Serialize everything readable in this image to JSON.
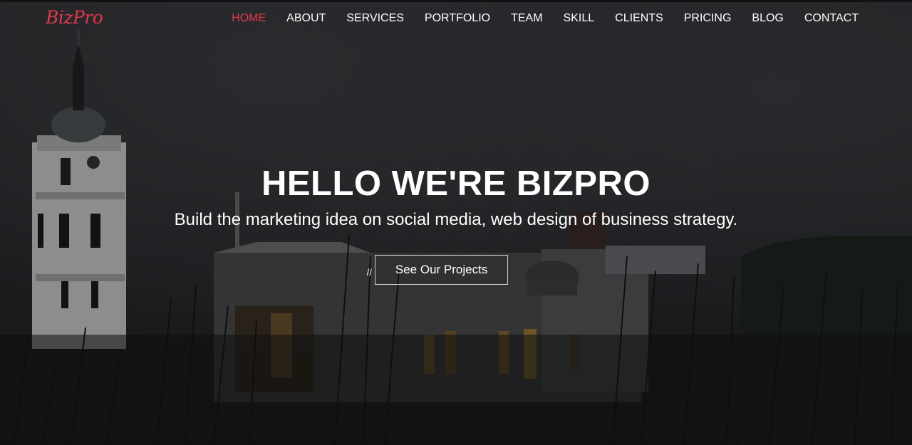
{
  "brand": {
    "logo_text": "BizPro",
    "accent_color": "#e4364d"
  },
  "nav": {
    "items": [
      {
        "label": "HOME",
        "active": true
      },
      {
        "label": "ABOUT",
        "active": false
      },
      {
        "label": "SERVICES",
        "active": false
      },
      {
        "label": "PORTFOLIO",
        "active": false
      },
      {
        "label": "TEAM",
        "active": false
      },
      {
        "label": "SKILL",
        "active": false
      },
      {
        "label": "CLIENTS",
        "active": false
      },
      {
        "label": "PRICING",
        "active": false
      },
      {
        "label": "BLOG",
        "active": false
      },
      {
        "label": "CONTACT",
        "active": false
      }
    ]
  },
  "hero": {
    "title": "HELLO WE'RE BIZPRO",
    "subtitle": "Build the marketing idea on social media, web design of business strategy.",
    "cta_prefix": "//",
    "cta_label": "See Our Projects",
    "background": "night-city-cathedral-photo"
  }
}
